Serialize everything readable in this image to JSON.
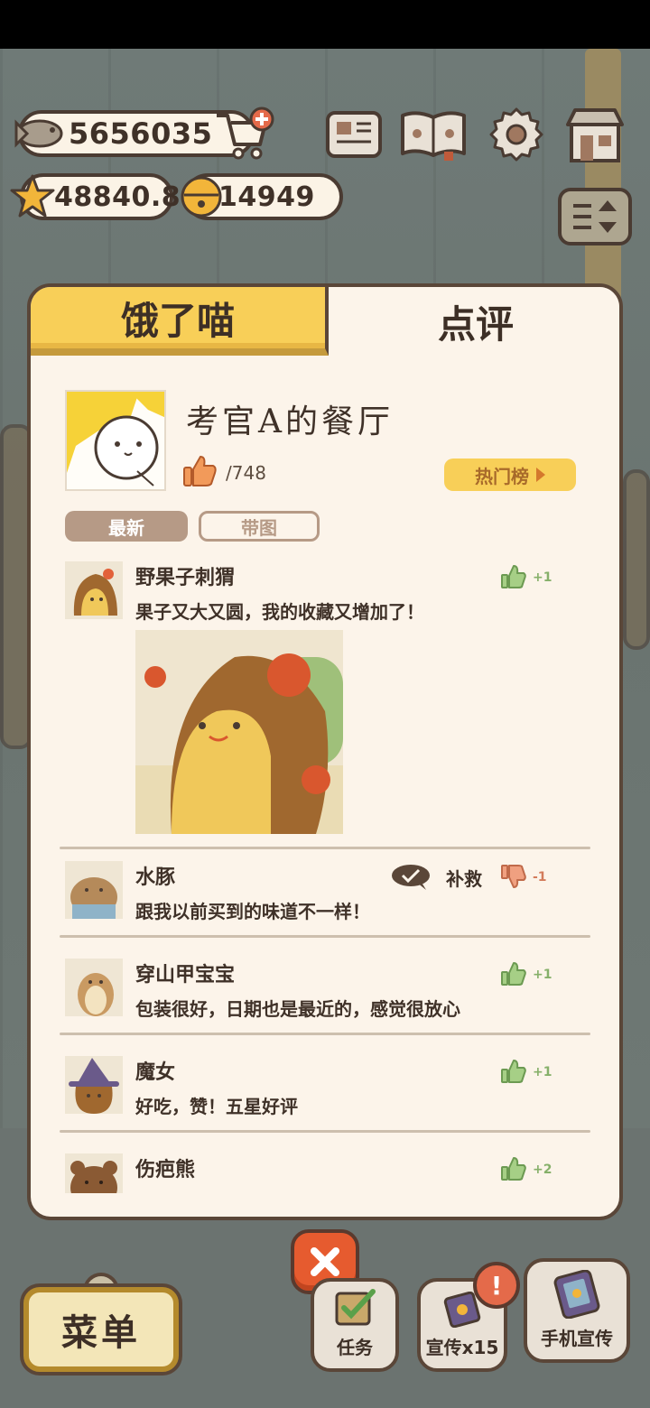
{
  "hud": {
    "fish_count": "5656035",
    "star_count": "48840.8",
    "bell_count": "14949"
  },
  "tabs": {
    "left": "饿了喵",
    "right": "点评"
  },
  "restaurant": {
    "name": "考官A的餐厅",
    "likes": "/748",
    "hot_list": "热门榜"
  },
  "filters": {
    "latest": "最新",
    "with_image": "带图"
  },
  "reviews": [
    {
      "name": "野果子刺猬",
      "text": "果子又大又圆，我的收藏又增加了！",
      "count": "+1",
      "type": "like",
      "has_image": true
    },
    {
      "name": "水豚",
      "text": "跟我以前买到的味道不一样！",
      "count": "-1",
      "type": "dislike",
      "reply": "补救"
    },
    {
      "name": "穿山甲宝宝",
      "text": "包装很好，日期也是最近的，感觉很放心",
      "count": "+1",
      "type": "like"
    },
    {
      "name": "魔女",
      "text": "好吃，赞！五星好评",
      "count": "+1",
      "type": "like"
    },
    {
      "name": "伤疤熊",
      "text": "",
      "count": "+2",
      "type": "like"
    }
  ],
  "bottom": {
    "menu": "菜单",
    "tasks": "任务",
    "promo": "宣传x15",
    "phone_promo": "手机宣传",
    "alert": "!"
  },
  "colors": {
    "tab_active": "#f8cf58",
    "panel_bg": "#fcf4ea",
    "border": "#5a4638",
    "like_green": "#86b06a",
    "dislike_red": "#d37b5b",
    "close_red": "#e65b2f"
  }
}
